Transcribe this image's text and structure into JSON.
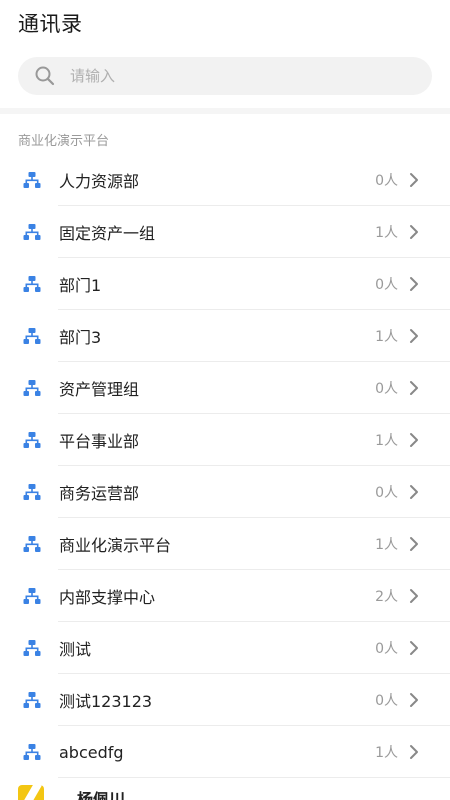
{
  "header": {
    "title": "通讯录"
  },
  "search": {
    "placeholder": "请输入",
    "icon": "search-icon"
  },
  "section": {
    "title": "商业化演示平台"
  },
  "colors": {
    "accent": "#3a82e4",
    "chevron": "#888888",
    "avatar": "#f3c613"
  },
  "departments": [
    {
      "name": "人力资源部",
      "count": "0人"
    },
    {
      "name": "固定资产一组",
      "count": "1人"
    },
    {
      "name": "部门1",
      "count": "0人"
    },
    {
      "name": "部门3",
      "count": "1人"
    },
    {
      "name": "资产管理组",
      "count": "0人"
    },
    {
      "name": "平台事业部",
      "count": "1人"
    },
    {
      "name": "商务运营部",
      "count": "0人"
    },
    {
      "name": "商业化演示平台",
      "count": "1人"
    },
    {
      "name": "内部支撑中心",
      "count": "2人"
    },
    {
      "name": "测试",
      "count": "0人"
    },
    {
      "name": "测试123123",
      "count": "0人"
    },
    {
      "name": "abcedfg",
      "count": "1人"
    }
  ],
  "people": [
    {
      "name": "杨佩川"
    }
  ]
}
